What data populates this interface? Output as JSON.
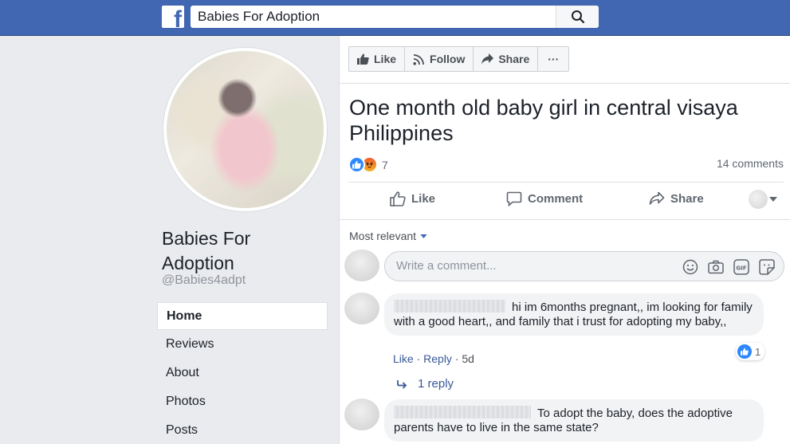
{
  "topbar": {
    "logo_letter": "f",
    "search_value": "Babies For Adoption",
    "search_icon": "search-icon",
    "brand_color": "#4267b2"
  },
  "sidebar": {
    "page_name": "Babies For Adoption",
    "page_handle": "@Babies4adpt",
    "nav": [
      {
        "label": "Home",
        "active": true
      },
      {
        "label": "Reviews"
      },
      {
        "label": "About"
      },
      {
        "label": "Photos"
      },
      {
        "label": "Posts"
      }
    ]
  },
  "page_actions": {
    "like": "Like",
    "follow": "Follow",
    "share": "Share",
    "more": "···"
  },
  "post": {
    "title": "One month old baby girl in central visaya Philippines",
    "reaction_icons": [
      "like-reaction-icon",
      "angry-reaction-icon"
    ],
    "reaction_count": "7",
    "comments_count": "14 comments",
    "actions": {
      "like": "Like",
      "comment": "Comment",
      "share": "Share"
    },
    "sort_label": "Most relevant"
  },
  "composer": {
    "placeholder": "Write a comment...",
    "icons": [
      "emoji-icon",
      "camera-icon",
      "gif-icon",
      "sticker-icon"
    ]
  },
  "comments": [
    {
      "text": "hi im 6months pregnant,, im looking for family with a good heart,, and family that i trust for adopting my baby,,",
      "like": "Like",
      "reply": "Reply",
      "age": "5d",
      "like_count": "1",
      "replies_label": "1 reply"
    },
    {
      "text": "To adopt the baby, does the adoptive parents have to live in the same state?"
    }
  ],
  "colors": {
    "link": "#385898",
    "like_blue": "#2d88ff",
    "background": "#e9ebee"
  }
}
